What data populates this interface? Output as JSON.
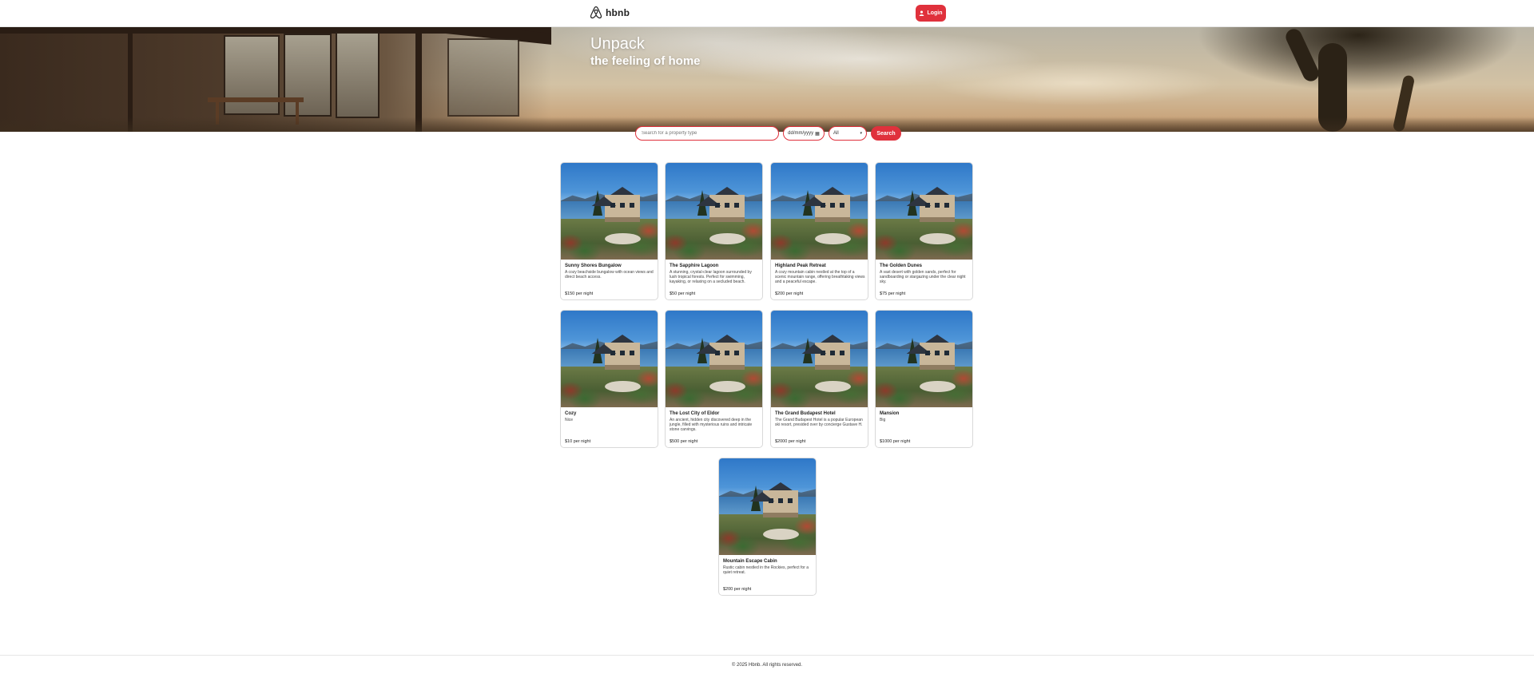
{
  "header": {
    "logo_text": "hbnb",
    "login_label": "Login",
    "accent_color": "#e0313c"
  },
  "hero": {
    "title": "Unpack",
    "subtitle": "the feeling of home"
  },
  "search": {
    "placeholder": "Search for a property type",
    "date_placeholder": "dd/mm/yyyy",
    "type_selected": "All",
    "button_label": "Search"
  },
  "listings": [
    {
      "title": "Sunny Shores Bungalow",
      "description": "A cozy beachside bungalow with ocean views and direct beach access.",
      "price": "$150 per night"
    },
    {
      "title": "The Sapphire Lagoon",
      "description": "A stunning, crystal-clear lagoon surrounded by lush tropical forests. Perfect for swimming, kayaking, or relaxing on a secluded beach.",
      "price": "$50 per night"
    },
    {
      "title": "Highland Peak Retreat",
      "description": "A cozy mountain cabin nestled at the top of a scenic mountain range, offering breathtaking views and a peaceful escape.",
      "price": "$200 per night"
    },
    {
      "title": "The Golden Dunes",
      "description": "A vast desert with golden sands, perfect for sandboarding or stargazing under the clear night sky.",
      "price": "$75 per night"
    },
    {
      "title": "Cozy",
      "description": "Nice",
      "price": "$10 per night"
    },
    {
      "title": "The Lost City of Eldor",
      "description": "An ancient, hidden city discovered deep in the jungle, filled with mysterious ruins and intricate stone carvings.",
      "price": "$500 per night"
    },
    {
      "title": "The Grand Budapest Hotel",
      "description": "The Grand Budapest Hotel is a popular European ski resort, presided over by concierge Gustave H.",
      "price": "$2000 per night"
    },
    {
      "title": "Mansion",
      "description": "Big",
      "price": "$1000 per night"
    },
    {
      "title": "Mountain Escape Cabin",
      "description": "Rustic cabin nestled in the Rockies, perfect for a quiet retreat.",
      "price": "$200 per night"
    }
  ],
  "footer": {
    "copyright": "© 2025 Hbnb. All rights reserved."
  }
}
